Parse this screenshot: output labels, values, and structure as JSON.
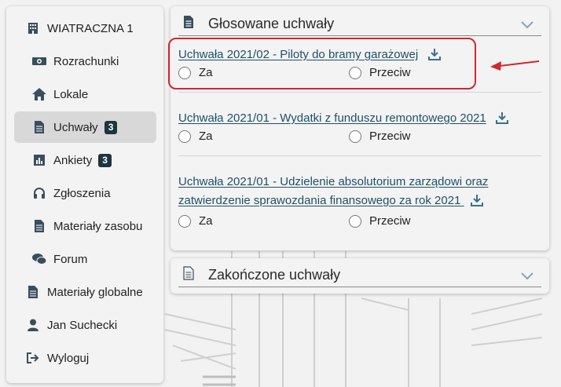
{
  "sidebar": {
    "items": [
      {
        "label": "WIATRACZNA 1",
        "icon": "building-icon"
      },
      {
        "label": "Rozrachunki",
        "icon": "money-icon"
      },
      {
        "label": "Lokale",
        "icon": "home-icon"
      },
      {
        "label": "Uchwały",
        "icon": "document-icon",
        "badge": "3",
        "active": true
      },
      {
        "label": "Ankiety",
        "icon": "bar-chart-icon",
        "badge": "3"
      },
      {
        "label": "Zgłoszenia",
        "icon": "headset-icon"
      },
      {
        "label": "Materiały zasobu",
        "icon": "document-icon"
      },
      {
        "label": "Forum",
        "icon": "chat-icon"
      },
      {
        "label": "Materiały globalne",
        "icon": "document-icon"
      },
      {
        "label": "Jan Suchecki",
        "icon": "user-icon"
      },
      {
        "label": "Wyloguj",
        "icon": "logout-icon"
      }
    ]
  },
  "voted": {
    "title": "Głosowane uchwały",
    "resolutions": [
      {
        "title": "Uchwała 2021/02 - Piloty do bramy garażowej",
        "option_yes": "Za",
        "option_no": "Przeciw"
      },
      {
        "title": "Uchwała 2021/01 - Wydatki z funduszu remontowego 2021",
        "option_yes": "Za",
        "option_no": "Przeciw"
      },
      {
        "title_line1": "Uchwała 2021/01 - Udzielenie absolutorium zarządowi oraz",
        "title_line2": "zatwierdzenie sprawozdania finansowego za rok 2021",
        "option_yes": "Za",
        "option_no": "Przeciw"
      }
    ]
  },
  "finished": {
    "title": "Zakończone uchwały"
  },
  "colors": {
    "link": "#1f5068",
    "badge": "#1e3440",
    "annotation": "#d0282e"
  }
}
